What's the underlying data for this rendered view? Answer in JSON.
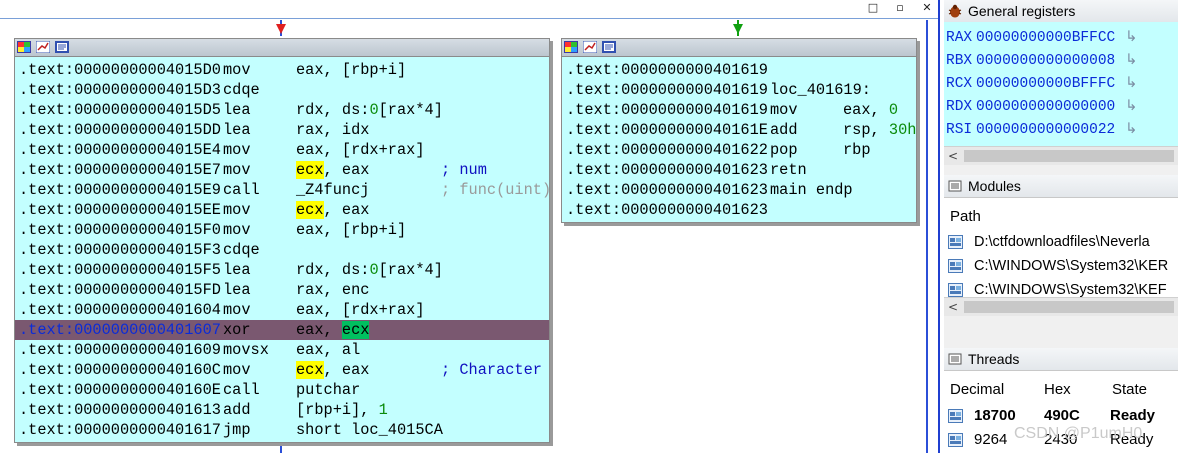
{
  "window_buttons": {
    "restore": "□",
    "maximize": "▫",
    "close": "✕"
  },
  "left_block": {
    "lines": [
      {
        "addr": ".text:00000000004015D0",
        "op": "mov",
        "args": [
          {
            "t": "eax, [rbp+i]"
          }
        ],
        "comment": ""
      },
      {
        "addr": ".text:00000000004015D3",
        "op": "cdqe",
        "args": [],
        "comment": ""
      },
      {
        "addr": ".text:00000000004015D5",
        "op": "lea",
        "args": [
          {
            "t": "rdx, ds:"
          },
          {
            "t": "0",
            "c": "num"
          },
          {
            "t": "[rax*4]"
          }
        ],
        "comment": ""
      },
      {
        "addr": ".text:00000000004015DD",
        "op": "lea",
        "args": [
          {
            "t": "rax, idx"
          }
        ],
        "comment": ""
      },
      {
        "addr": ".text:00000000004015E4",
        "op": "mov",
        "args": [
          {
            "t": "eax, [rdx+rax]"
          }
        ],
        "comment": ""
      },
      {
        "addr": ".text:00000000004015E7",
        "op": "mov",
        "args": [
          {
            "t": "ecx",
            "c": "hl-y"
          },
          {
            "t": ", eax"
          }
        ],
        "comment": "; num"
      },
      {
        "addr": ".text:00000000004015E9",
        "op": "call",
        "args": [
          {
            "t": "_Z4funcj",
            "c": "under"
          }
        ],
        "comment": "; func(uint)",
        "comment_gray": true
      },
      {
        "addr": ".text:00000000004015EE",
        "op": "mov",
        "args": [
          {
            "t": "ecx",
            "c": "hl-y"
          },
          {
            "t": ", eax"
          }
        ],
        "comment": ""
      },
      {
        "addr": ".text:00000000004015F0",
        "op": "mov",
        "args": [
          {
            "t": "eax, [rbp+i]"
          }
        ],
        "comment": ""
      },
      {
        "addr": ".text:00000000004015F3",
        "op": "cdqe",
        "args": [],
        "comment": ""
      },
      {
        "addr": ".text:00000000004015F5",
        "op": "lea",
        "args": [
          {
            "t": "rdx, ds:"
          },
          {
            "t": "0",
            "c": "num"
          },
          {
            "t": "[rax*4]"
          }
        ],
        "comment": ""
      },
      {
        "addr": ".text:00000000004015FD",
        "op": "lea",
        "args": [
          {
            "t": "rax, enc"
          }
        ],
        "comment": ""
      },
      {
        "addr": ".text:0000000000401604",
        "op": "mov",
        "args": [
          {
            "t": "eax, [rdx+rax]"
          }
        ],
        "comment": ""
      },
      {
        "addr": ".text:0000000000401607",
        "op": "xor",
        "args": [
          {
            "t": "eax, "
          },
          {
            "t": "ecx",
            "c": "hl-g"
          }
        ],
        "comment": "",
        "selected": true
      },
      {
        "addr": ".text:0000000000401609",
        "op": "movsx",
        "args": [
          {
            "t": "eax, al"
          }
        ],
        "comment": ""
      },
      {
        "addr": ".text:000000000040160C",
        "op": "mov",
        "args": [
          {
            "t": "ecx",
            "c": "hl-y"
          },
          {
            "t": ", eax"
          }
        ],
        "comment": "; Character"
      },
      {
        "addr": ".text:000000000040160E",
        "op": "call",
        "args": [
          {
            "t": "putchar"
          }
        ],
        "comment": ""
      },
      {
        "addr": ".text:0000000000401613",
        "op": "add",
        "args": [
          {
            "t": "[rbp+i], "
          },
          {
            "t": "1",
            "c": "num"
          }
        ],
        "comment": ""
      },
      {
        "addr": ".text:0000000000401617",
        "op": "jmp",
        "args": [
          {
            "t": "short loc_4015CA"
          }
        ],
        "comment": ""
      }
    ]
  },
  "right_block": {
    "lines": [
      {
        "addr": ".text:0000000000401619",
        "op": "",
        "args": [],
        "comment": ""
      },
      {
        "addr": ".text:0000000000401619",
        "op": "loc_401619:",
        "args": [],
        "comment": ""
      },
      {
        "addr": ".text:0000000000401619",
        "op": "mov",
        "args": [
          {
            "t": "eax, "
          },
          {
            "t": "0",
            "c": "num"
          }
        ],
        "comment": ""
      },
      {
        "addr": ".text:000000000040161E",
        "op": "add",
        "args": [
          {
            "t": "rsp, "
          },
          {
            "t": "30h",
            "c": "num"
          }
        ],
        "comment": ""
      },
      {
        "addr": ".text:0000000000401622",
        "op": "pop",
        "args": [
          {
            "t": "rbp"
          }
        ],
        "comment": ""
      },
      {
        "addr": ".text:0000000000401623",
        "op": "retn",
        "args": [],
        "comment": ""
      },
      {
        "addr": ".text:0000000000401623",
        "op": "main endp",
        "args": [],
        "comment": ""
      },
      {
        "addr": ".text:0000000000401623",
        "op": "",
        "args": [],
        "comment": ""
      }
    ]
  },
  "registers": {
    "title": "General registers",
    "rows": [
      {
        "name": "RAX",
        "value": "00000000000BFFCC"
      },
      {
        "name": "RBX",
        "value": "0000000000000008"
      },
      {
        "name": "RCX",
        "value": "00000000000BFFFC"
      },
      {
        "name": "RDX",
        "value": "0000000000000000"
      },
      {
        "name": "RSI",
        "value": "0000000000000022"
      },
      {
        "name": "",
        "value": "  .. .......  . ..."
      }
    ],
    "arrow": "↳"
  },
  "modules": {
    "title": "Modules",
    "column": "Path",
    "rows": [
      "D:\\ctfdownloadfiles\\Neverla",
      "C:\\WINDOWS\\System32\\KER",
      "C:\\WINDOWS\\System32\\KEF"
    ]
  },
  "threads": {
    "title": "Threads",
    "columns": [
      "Decimal",
      "Hex",
      "State"
    ],
    "rows": [
      {
        "decimal": "18700",
        "hex": "490C",
        "state": "Ready",
        "bold": true
      },
      {
        "decimal": "9264",
        "hex": "2430",
        "state": "Ready",
        "bold": false
      }
    ]
  },
  "watermark": "CSDN @P1umH0",
  "colors": {
    "block_bg": "#c3ffff",
    "selected_line": "#7a5870",
    "edge_blue": "#2b4fd8",
    "edge_red": "#e02020",
    "edge_green": "#10a010"
  }
}
